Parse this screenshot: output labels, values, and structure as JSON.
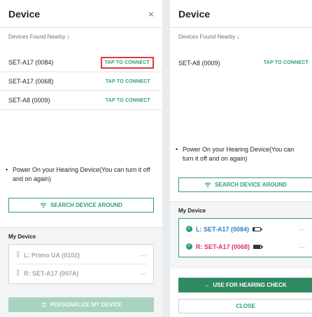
{
  "left": {
    "title": "Device",
    "close": "×",
    "nearby_label": "Devices Found Nearby",
    "nearby_arrow": "↓",
    "devices": [
      {
        "name": "SET-A17 (0084)",
        "action": "TAP TO CONNECT"
      },
      {
        "name": "SET-A17 (0068)",
        "action": "TAP TO CONNECT"
      },
      {
        "name": "SET-A8 (0009)",
        "action": "TAP TO CONNECT"
      }
    ],
    "power_text": "Power On your Hearing Device(You can turn it off and on again)",
    "search_button": "SEARCH DEVICE AROUND",
    "my_device_title": "My Device",
    "my_devices": [
      {
        "name": "L: Primo UA (0102)",
        "status": "—"
      },
      {
        "name": "R: SET-A17 (007A)",
        "status": "—"
      }
    ],
    "personalize_button": "PERSONALIZE MY DEVICE"
  },
  "right": {
    "title": "Device",
    "nearby_label": "Devices Found Nearby",
    "nearby_arrow": "↓",
    "devices": [
      {
        "name": "SET-A8 (0009)",
        "action": "TAP TO CONNECT"
      }
    ],
    "power_text": "Power On your Hearing Device(You can turn it off and on again)",
    "search_button": "SEARCH DEVICE AROUND",
    "my_device_title": "My Device",
    "my_devices": [
      {
        "name": "L: SET-A17 (0084)",
        "status": "—",
        "battery": 0.2
      },
      {
        "name": "R: SET-A17 (0068)",
        "status": "—",
        "battery": 0.85
      }
    ],
    "use_button": "USE FOR HEARING CHECK",
    "close_button": "CLOSE"
  },
  "colors": {
    "accent": "#2e9e73",
    "accent_dark": "#2f8a62",
    "highlight": "#e53935",
    "left_ear": "#2e7fc6",
    "right_ear": "#d6336c"
  }
}
